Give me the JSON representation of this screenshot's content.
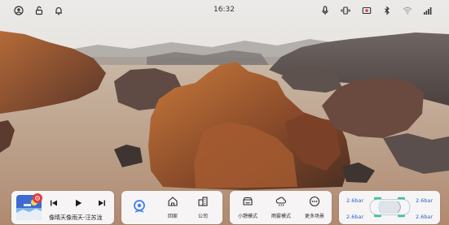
{
  "status_bar": {
    "time": "16:32",
    "left_icons": [
      "user-icon",
      "unlock-icon",
      "bell-icon"
    ],
    "right_icons": [
      "microphone-icon",
      "vibrate-icon",
      "record-icon",
      "bluetooth-icon",
      "wifi-icon",
      "signal-icon"
    ]
  },
  "media": {
    "song": "像晴天像雨天-汪苏泷",
    "app_badge_color": "#e63b3b",
    "controls": [
      "prev-icon",
      "play-icon",
      "next-icon"
    ]
  },
  "navigation": {
    "logo_icon": "nav-logo-icon",
    "shortcuts": [
      {
        "label": "回家",
        "icon": "home-icon"
      },
      {
        "label": "公司",
        "icon": "office-icon"
      }
    ]
  },
  "scenes": [
    {
      "label": "小憩模式",
      "icon": "nap-icon"
    },
    {
      "label": "雨雾模式",
      "icon": "rain-cloud-icon"
    },
    {
      "label": "更多场景",
      "icon": "more-icon"
    }
  ],
  "tire_pressure": {
    "front_left": "2.6bar",
    "front_right": "2.6bar",
    "rear_left": "2.6bar",
    "rear_right": "2.6bar",
    "status_color": "#34c6a2"
  }
}
